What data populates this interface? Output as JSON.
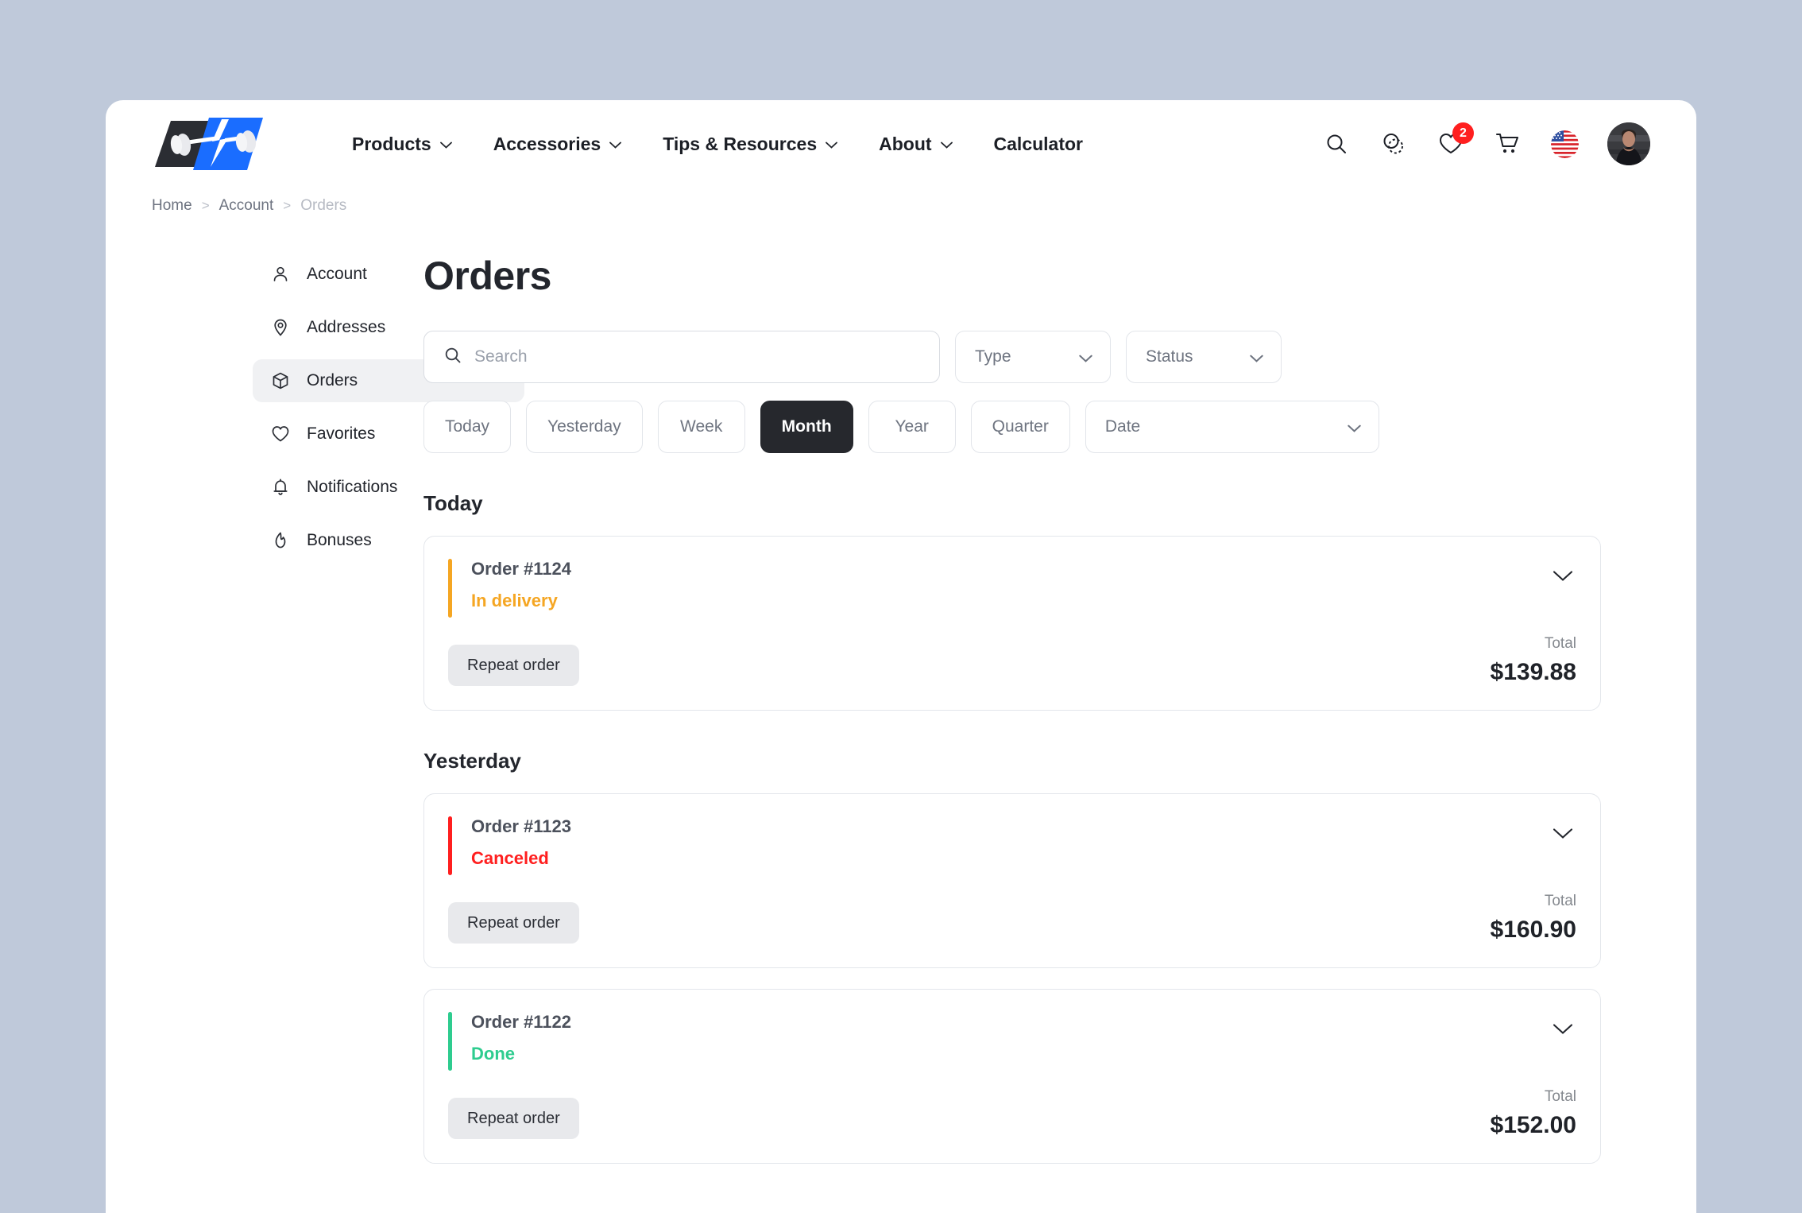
{
  "brand": {
    "logo_alt": "dumbbell-logo",
    "dark_color": "#2b2d33",
    "blue_color": "#1a6dff"
  },
  "nav": {
    "items": [
      {
        "label": "Products",
        "has_dropdown": true
      },
      {
        "label": "Accessories",
        "has_dropdown": true
      },
      {
        "label": "Tips & Resources",
        "has_dropdown": true
      },
      {
        "label": "About",
        "has_dropdown": true
      },
      {
        "label": "Calculator",
        "has_dropdown": false
      }
    ]
  },
  "header_icons": {
    "search": "search-icon",
    "compare": "compare-icon",
    "favorites": "heart-icon",
    "favorites_badge": "2",
    "cart": "cart-icon",
    "language": "us-flag-icon",
    "avatar": "user-avatar"
  },
  "breadcrumb": {
    "items": [
      "Home",
      "Account",
      "Orders"
    ],
    "separator": ">"
  },
  "sidebar": {
    "items": [
      {
        "label": "Account",
        "icon": "user-icon",
        "active": false
      },
      {
        "label": "Addresses",
        "icon": "location-pin-icon",
        "active": false
      },
      {
        "label": "Orders",
        "icon": "box-icon",
        "active": true
      },
      {
        "label": "Favorites",
        "icon": "heart-icon",
        "active": false
      },
      {
        "label": "Notifications",
        "icon": "bell-icon",
        "active": false
      },
      {
        "label": "Bonuses",
        "icon": "flame-icon",
        "active": false
      }
    ]
  },
  "main": {
    "page_title": "Orders",
    "search": {
      "value": "",
      "placeholder": "Search"
    },
    "type_filter": {
      "label": "Type",
      "value": ""
    },
    "status_filter": {
      "label": "Status",
      "value": ""
    },
    "period_chips": [
      {
        "label": "Today",
        "active": false
      },
      {
        "label": "Yesterday",
        "active": false
      },
      {
        "label": "Week",
        "active": false
      },
      {
        "label": "Month",
        "active": true
      },
      {
        "label": "Year",
        "active": false
      },
      {
        "label": "Quarter",
        "active": false
      }
    ],
    "date_filter": {
      "label": "Date",
      "value": ""
    },
    "totals_label": "Total",
    "repeat_label": "Repeat order",
    "groups": [
      {
        "title": "Today",
        "orders": [
          {
            "number": "Order #1124",
            "status": "In delivery",
            "status_color": "#f5a623",
            "total": "$139.88",
            "total_label": "Total",
            "repeat_label": "Repeat order"
          }
        ]
      },
      {
        "title": "Yesterday",
        "orders": [
          {
            "number": "Order #1123",
            "status": "Canceled",
            "status_color": "#ff1f1f",
            "total": "$160.90",
            "total_label": "Total",
            "repeat_label": "Repeat order"
          },
          {
            "number": "Order #1122",
            "status": "Done",
            "status_color": "#2ecc8f",
            "total": "$152.00",
            "total_label": "Total",
            "repeat_label": "Repeat order"
          }
        ]
      }
    ]
  }
}
